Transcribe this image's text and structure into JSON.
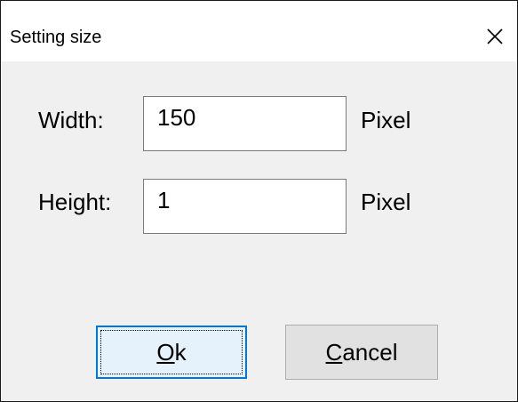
{
  "window": {
    "title": "Setting size",
    "close_icon": "close-icon"
  },
  "form": {
    "width": {
      "label": "Width:",
      "value": "150",
      "unit": "Pixel"
    },
    "height": {
      "label": "Height:",
      "value": "1",
      "unit": "Pixel"
    }
  },
  "buttons": {
    "ok": {
      "mnemonic": "O",
      "rest": "k"
    },
    "cancel": {
      "mnemonic": "C",
      "rest": "ancel"
    }
  },
  "colors": {
    "focus_border": "#0078d7",
    "dialog_background": "#f0f0f0",
    "titlebar_background": "#ffffff"
  }
}
